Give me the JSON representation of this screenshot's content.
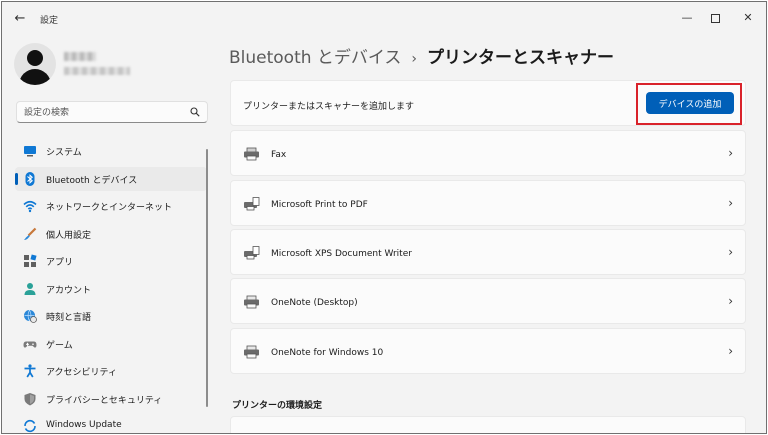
{
  "window": {
    "title": "設定",
    "back_glyph": "←",
    "minimize_glyph": "—",
    "close_glyph": "✕"
  },
  "search": {
    "placeholder": "設定の検索"
  },
  "sidebar": {
    "items": [
      {
        "label": "システム",
        "icon": "monitor-icon"
      },
      {
        "label": "Bluetooth とデバイス",
        "icon": "bluetooth-icon",
        "selected": true
      },
      {
        "label": "ネットワークとインターネット",
        "icon": "wifi-icon"
      },
      {
        "label": "個人用設定",
        "icon": "paintbrush-icon"
      },
      {
        "label": "アプリ",
        "icon": "apps-icon"
      },
      {
        "label": "アカウント",
        "icon": "account-icon"
      },
      {
        "label": "時刻と言語",
        "icon": "globe-clock-icon"
      },
      {
        "label": "ゲーム",
        "icon": "gamepad-icon"
      },
      {
        "label": "アクセシビリティ",
        "icon": "accessibility-icon"
      },
      {
        "label": "プライバシーとセキュリティ",
        "icon": "shield-icon"
      },
      {
        "label": "Windows Update",
        "icon": "update-icon"
      }
    ]
  },
  "breadcrumb": {
    "parent": "Bluetooth とデバイス",
    "separator": "›",
    "current": "プリンターとスキャナー"
  },
  "add_device": {
    "label": "プリンターまたはスキャナーを追加します",
    "button": "デバイスの追加"
  },
  "printers": [
    {
      "name": "Fax",
      "icon": "fax-icon"
    },
    {
      "name": "Microsoft Print to PDF",
      "icon": "printer-doc-icon"
    },
    {
      "name": "Microsoft XPS Document Writer",
      "icon": "printer-doc-icon"
    },
    {
      "name": "OneNote (Desktop)",
      "icon": "printer-icon"
    },
    {
      "name": "OneNote for Windows 10",
      "icon": "printer-icon"
    }
  ],
  "chevron": "›",
  "section": {
    "title": "プリンターの環境設定"
  },
  "colors": {
    "accent": "#005fb8",
    "highlight_box": "#d9222a"
  }
}
